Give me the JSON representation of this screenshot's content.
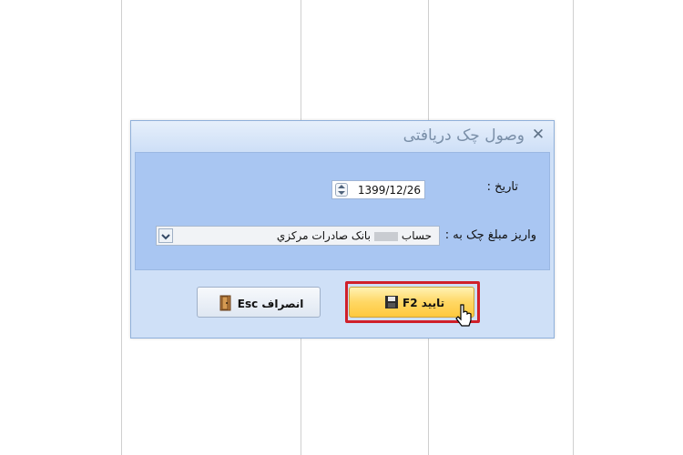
{
  "dialog": {
    "title": "وصول چک دریافتی",
    "close_label": "✕"
  },
  "form": {
    "date_label": "تاریخ :",
    "date_value": "1399/12/26",
    "deposit_label": "واریز مبلغ چک به :",
    "deposit_value_prefix": "حساب",
    "deposit_value_suffix": "بانک صادرات مرکزي"
  },
  "buttons": {
    "ok_label": "تاييد F2",
    "cancel_label": "انصراف Esc"
  },
  "icons": [
    "calendar-spin-icon",
    "dropdown-arrow-icon",
    "save-disk-icon",
    "exit-door-icon",
    "mouse-cursor-icon"
  ],
  "colors": {
    "dialog_bg": "#cfe0f7",
    "content_bg": "#a9c6f2",
    "highlight": "#d0202a",
    "ok_button": "#ffd764"
  }
}
